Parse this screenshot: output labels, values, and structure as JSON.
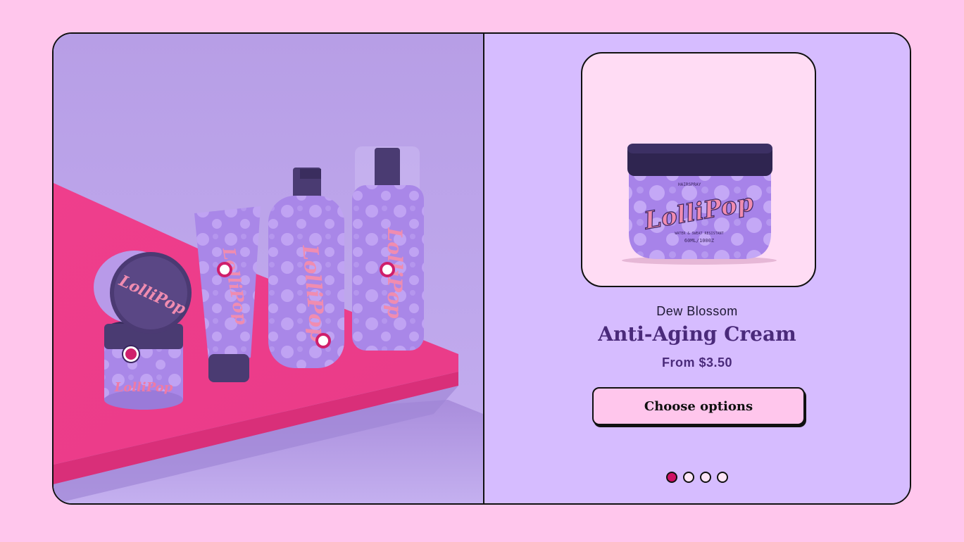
{
  "product": {
    "brand": "Dew Blossom",
    "title": "Anti-Aging Cream",
    "price": "From $3.50",
    "cta_label": "Choose options",
    "image_logo_text": "LolliPop",
    "jar_label_top": "HAIRSPRAY",
    "jar_label_bottom": "WATER & SWEAT RESISTANT",
    "jar_volume": "60ML/1000Z"
  },
  "scene": {
    "logo_text": "LolliPop",
    "hotspots": [
      {
        "name": "hotspot-jar",
        "active": true
      },
      {
        "name": "hotspot-tube",
        "active": false
      },
      {
        "name": "hotspot-pump-bottle",
        "active": false
      },
      {
        "name": "hotspot-spray-bottle",
        "active": false
      }
    ]
  },
  "carousel": {
    "slides": 4,
    "active_index": 0
  },
  "colors": {
    "page_bg": "#ffc6ec",
    "panel_bg": "#d6bcff",
    "accent": "#cf1064",
    "title": "#4a2a7a"
  }
}
